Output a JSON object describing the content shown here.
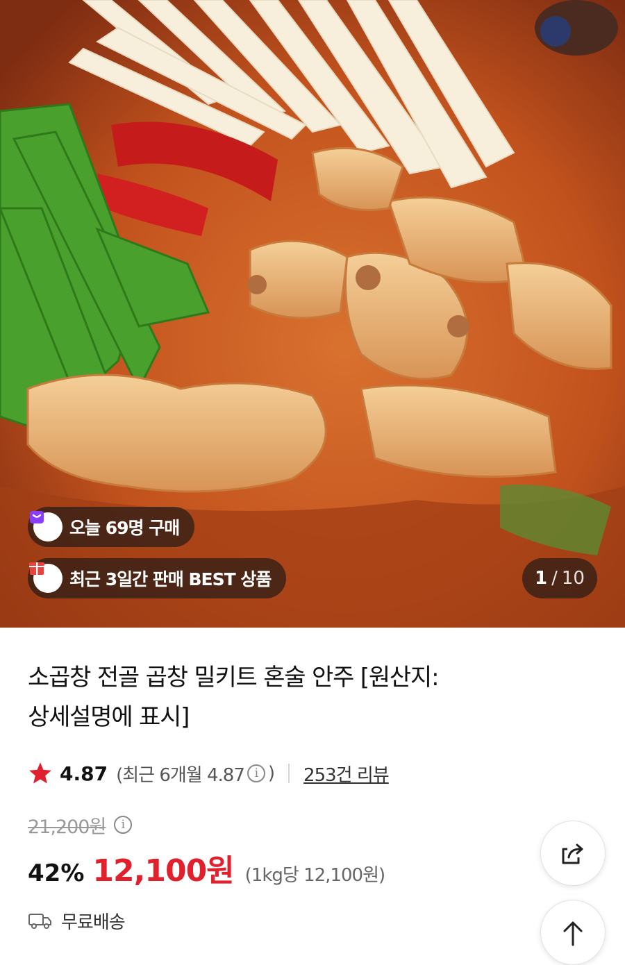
{
  "hero": {
    "image_name": "gopchang-stew-photo",
    "badges": [
      {
        "icon": "shopping-bag-icon",
        "text": "오늘 69명 구매"
      },
      {
        "icon": "gift-box-icon",
        "text": "최근 3일간 판매 BEST 상품"
      }
    ],
    "counter": {
      "current": "1",
      "separator": "/",
      "total": "10"
    }
  },
  "product": {
    "title_line1": "소곱창 전골 곱창 밀키트 혼술 안주 [원산지:",
    "title_line2": "상세설명에 표시]",
    "rating": {
      "star_icon": "star-icon",
      "value": "4.87",
      "recent_prefix": "(최근 6개월 4.87",
      "info_icon": "i",
      "recent_suffix": ")",
      "reviews": "253건 리뷰"
    },
    "price": {
      "original": "21,200원",
      "info_icon": "i",
      "discount": "42%",
      "sale": "12,100원",
      "unit": "(1kg당 12,100원)"
    },
    "shipping": {
      "icon": "truck-icon",
      "label": "무료배송"
    }
  },
  "colors": {
    "accent_red": "#e0202c",
    "badge_purple": "#8b3dff",
    "badge_red": "#e8433e",
    "overlay": "#281c16"
  },
  "actions": {
    "share_icon": "share-icon",
    "top_icon": "arrow-up-icon"
  }
}
